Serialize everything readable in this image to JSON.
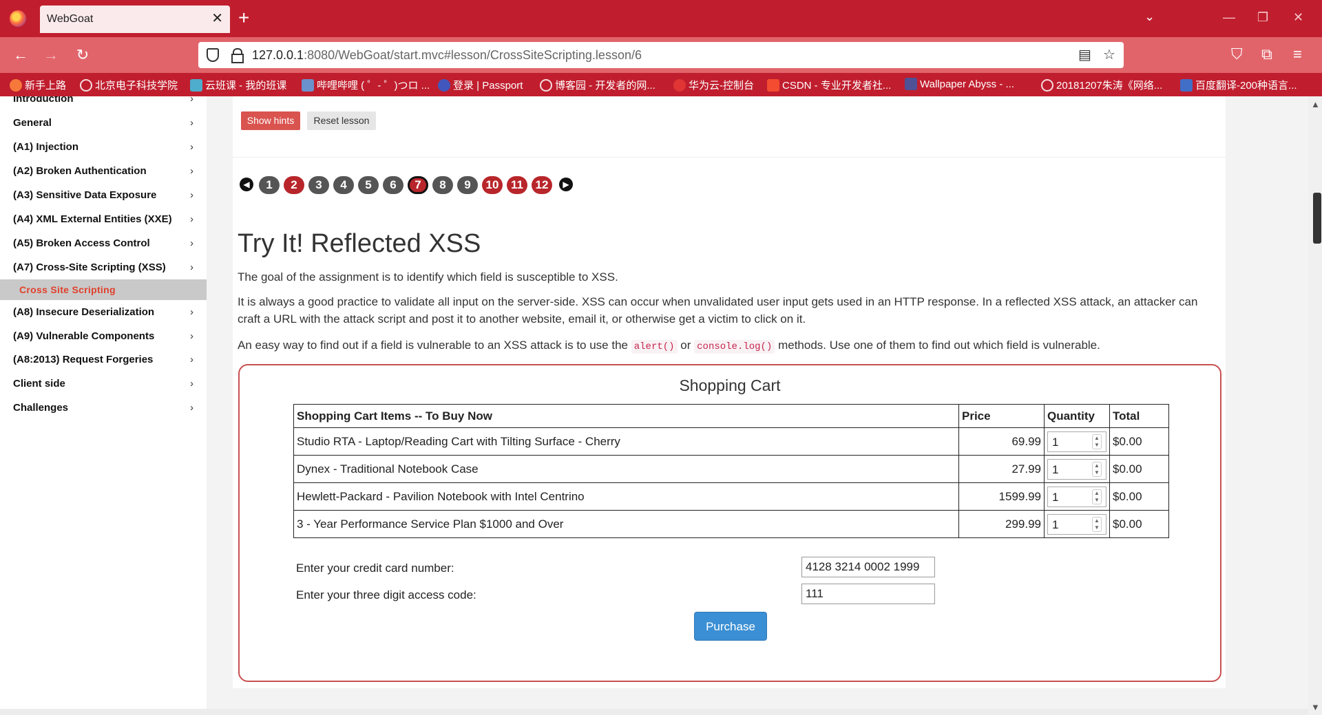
{
  "browser": {
    "tab_title": "WebGoat",
    "url_host": "127.0.0.1",
    "url_rest": ":8080/WebGoat/start.mvc#lesson/CrossSiteScripting.lesson/6",
    "bookmarks": [
      "新手上路",
      "北京电子科技学院",
      "云班课 - 我的班课",
      "哔哩哔哩 ( ゜- ゜)つロ ...",
      "登录 | Passport",
      "博客园 - 开发者的网...",
      "华为云-控制台",
      "CSDN - 专业开发者社...",
      "Wallpaper Abyss - ...",
      "20181207朱涛《网络...",
      "百度翻译-200种语言..."
    ],
    "colors": {
      "chrome": "#c01e2e",
      "nav": "#e2646b"
    }
  },
  "sidebar": {
    "items": [
      "Introduction",
      "General",
      "(A1) Injection",
      "(A2) Broken Authentication",
      "(A3) Sensitive Data Exposure",
      "(A4) XML External Entities (XXE)",
      "(A5) Broken Access Control",
      "(A7) Cross-Site Scripting (XSS)",
      "(A8) Insecure Deserialization",
      "(A9) Vulnerable Components",
      "(A8:2013) Request Forgeries",
      "Client side",
      "Challenges"
    ],
    "active_sub": "Cross Site Scripting",
    "chevron": "›"
  },
  "lesson": {
    "show_hints": "Show hints",
    "reset_lesson": "Reset lesson",
    "pages": [
      "1",
      "2",
      "3",
      "4",
      "5",
      "6",
      "7",
      "8",
      "9",
      "10",
      "11",
      "12"
    ],
    "current_page": "7",
    "title": "Try It! Reflected XSS",
    "p1": "The goal of the assignment is to identify which field is susceptible to XSS.",
    "p2": "It is always a good practice to validate all input on the server-side. XSS can occur when unvalidated user input gets used in an HTTP response. In a reflected XSS attack, an attacker can craft a URL with the attack script and post it to another website, email it, or otherwise get a victim to click on it.",
    "p3_a": "An easy way to find out if a field is vulnerable to an XSS attack is to use the",
    "p3_code1": "alert()",
    "p3_or": "or",
    "p3_code2": "console.log()",
    "p3_b": "methods. Use one of them to find out which field is vulnerable."
  },
  "cart": {
    "title": "Shopping Cart",
    "headers": [
      "Shopping Cart Items -- To Buy Now",
      "Price",
      "Quantity",
      "Total"
    ],
    "rows": [
      {
        "item": "Studio RTA - Laptop/Reading Cart with Tilting Surface - Cherry",
        "price": "69.99",
        "qty": "1",
        "total": "$0.00"
      },
      {
        "item": "Dynex - Traditional Notebook Case",
        "price": "27.99",
        "qty": "1",
        "total": "$0.00"
      },
      {
        "item": "Hewlett-Packard - Pavilion Notebook with Intel Centrino",
        "price": "1599.99",
        "qty": "1",
        "total": "$0.00"
      },
      {
        "item": "3 - Year Performance Service Plan $1000 and Over",
        "price": "299.99",
        "qty": "1",
        "total": "$0.00"
      }
    ],
    "cc_label": "Enter your credit card number:",
    "cc_value": "4128 3214 0002 1999",
    "code_label": "Enter your three digit access code:",
    "code_value": "111",
    "purchase": "Purchase"
  }
}
